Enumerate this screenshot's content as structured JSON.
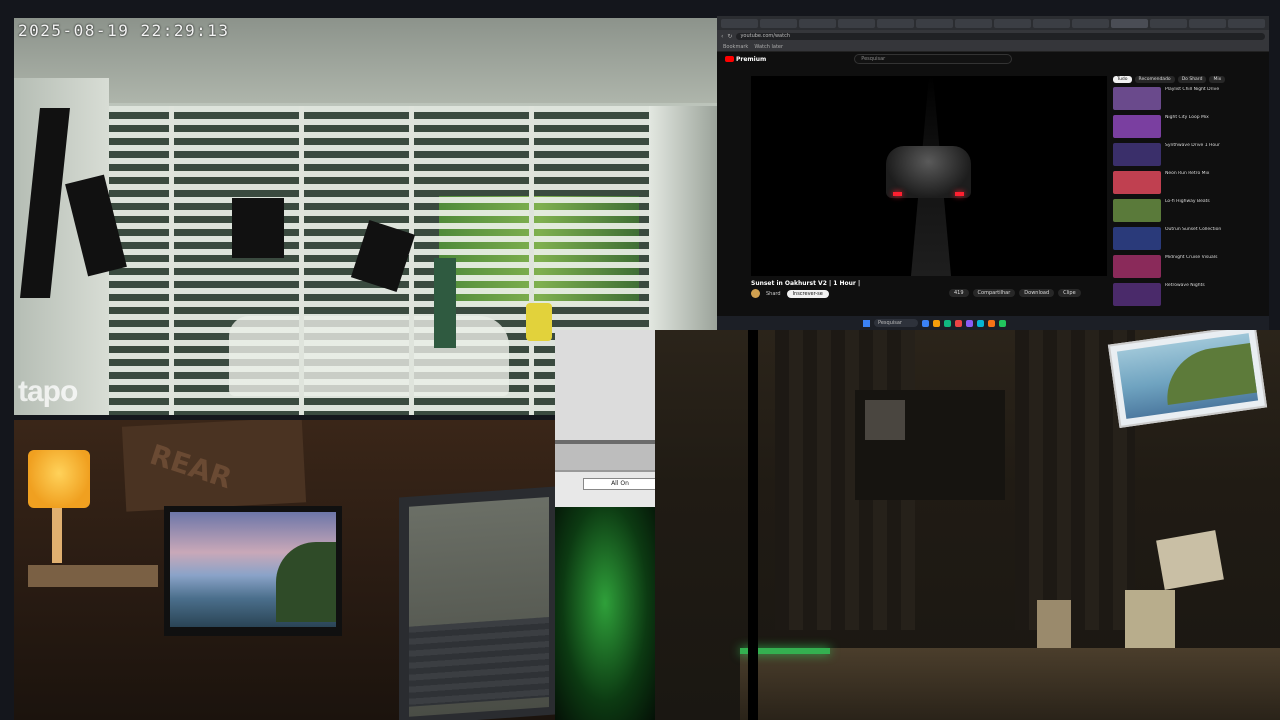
{
  "camera": {
    "timestamp": "2025-08-19  22:29:13",
    "brand_logo": "tapo"
  },
  "browser": {
    "url_text": "youtube.com/watch",
    "bookmarks": [
      "Bookmark",
      "Watch later"
    ],
    "youtube_logo": "Premium",
    "search_placeholder": "Pesquisar",
    "video_title": "Sunset in Oakhurst V2 | 1 Hour |",
    "channel_name": "Shard",
    "subscribe_label": "Inscrever-se",
    "actions": [
      "419",
      "Compartilhar",
      "Download",
      "Clipe"
    ],
    "chips": [
      "Tudo",
      "Recomendado",
      "Do Shard",
      "Mix"
    ],
    "recommendations": [
      {
        "title": "Playlist Chill Night Drive",
        "color": "#6a4a8c"
      },
      {
        "title": "Night City Loop Mix",
        "color": "#7a3fa0"
      },
      {
        "title": "Synthwave Drive 1 Hour",
        "color": "#3a2f6a"
      },
      {
        "title": "Neon Run Retro Mix",
        "color": "#c04050"
      },
      {
        "title": "Lo-fi Highway Beats",
        "color": "#5a7a3a"
      },
      {
        "title": "Outrun Sunset Collection",
        "color": "#2a3a7a"
      },
      {
        "title": "Midnight Cruise Visuals",
        "color": "#8a2a5a"
      },
      {
        "title": "Retrowave Nights",
        "color": "#4a2a6a"
      }
    ],
    "taskbar_search": "Pesquisar",
    "taskbar_icons": [
      "#3b82f6",
      "#f59e0b",
      "#10b981",
      "#ef4444",
      "#8b5cf6",
      "#06b6d4",
      "#f97316",
      "#22c55e"
    ]
  },
  "control_panel": {
    "all_on_label": "All On"
  },
  "room_bottom_left": {
    "poster_text": "REAR"
  }
}
